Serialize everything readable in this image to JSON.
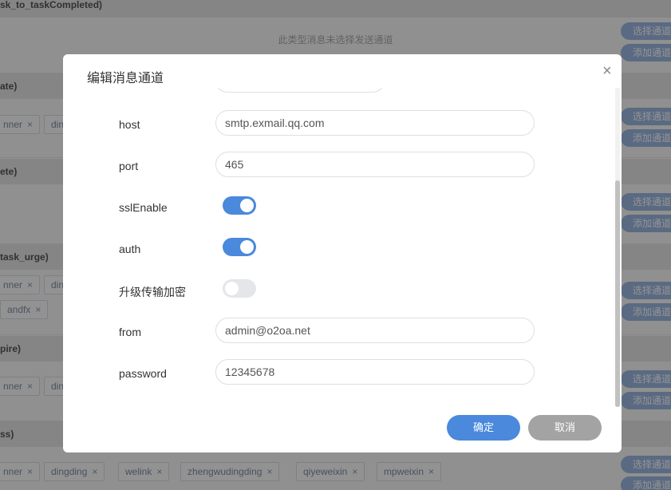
{
  "background": {
    "sections": [
      {
        "header": "sk_to_taskCompleted)",
        "empty_note": "此类型消息未选择发送通道",
        "tags": []
      },
      {
        "header": "ate)",
        "tags": [
          "nner",
          "din"
        ]
      },
      {
        "header": "ete)",
        "tags": []
      },
      {
        "header": "task_urge)",
        "tags": [
          "nner",
          "din",
          "andfx"
        ]
      },
      {
        "header": "pire)",
        "tags": [
          "nner",
          "din"
        ]
      },
      {
        "header": "ss)",
        "tags": [
          "nner",
          "dingding",
          "welink",
          "zhengwudingding",
          "qiyeweixin",
          "mpweixin"
        ]
      }
    ],
    "select_channel_label": "选择通道",
    "add_channel_label": "添加通道",
    "tag_close_glyph": "×"
  },
  "dialog": {
    "title": "编辑消息通道",
    "close_glyph": "×",
    "fields": {
      "host": {
        "label": "host",
        "value": "smtp.exmail.qq.com"
      },
      "port": {
        "label": "port",
        "value": "465"
      },
      "sslEnable": {
        "label": "sslEnable",
        "on": true
      },
      "auth": {
        "label": "auth",
        "on": true
      },
      "encryption": {
        "label": "升级传输加密",
        "on": false
      },
      "from": {
        "label": "from",
        "value": "admin@o2oa.net"
      },
      "password": {
        "label": "password",
        "value": "12345678"
      }
    },
    "confirm_label": "确定",
    "cancel_label": "取消"
  },
  "colors": {
    "accent": "#4a89dc",
    "cancel": "#a3a3a3",
    "pill": "#9bb7e0"
  }
}
